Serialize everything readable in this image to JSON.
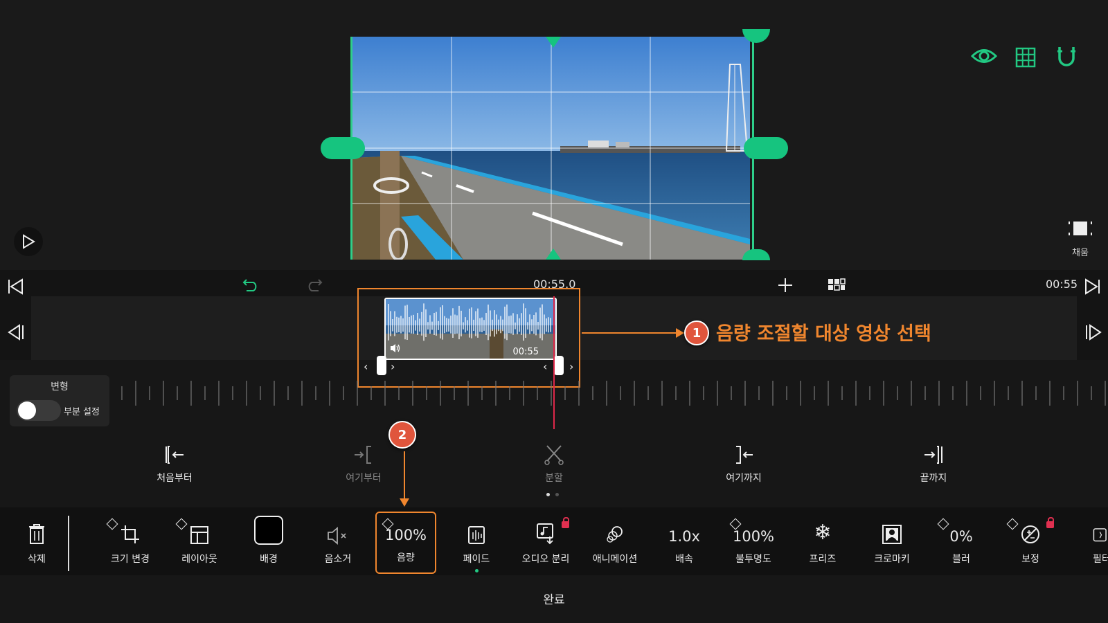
{
  "preview": {
    "fill_label": "채움",
    "icons": [
      "eye-icon",
      "grid-icon",
      "magnet-icon",
      "play-icon",
      "fill-icon"
    ],
    "accent_color": "#22c983"
  },
  "timeline": {
    "current_time": "00:55.0",
    "end_time": "00:55",
    "clip_duration": "00:55"
  },
  "callouts": {
    "one_number": "1",
    "one_text": "음량 조절할 대상 영상 선택",
    "two_number": "2",
    "color": "#f0862e"
  },
  "transform": {
    "title": "변형",
    "toggle_label": "부분 설정"
  },
  "trim_actions": [
    {
      "label": "처음부터"
    },
    {
      "label": "여기부터"
    },
    {
      "label": "분할"
    },
    {
      "label": "여기까지"
    },
    {
      "label": "끝까지"
    }
  ],
  "toolbar": {
    "delete": "삭제",
    "resize": "크기 변경",
    "layout": "레이아웃",
    "background": "배경",
    "mute": "음소거",
    "volume_value": "100%",
    "volume": "음량",
    "fade": "페이드",
    "audio_split": "오디오 분리",
    "animation": "애니메이션",
    "speed_value": "1.0x",
    "speed": "배속",
    "opacity_value": "100%",
    "opacity": "불투명도",
    "freeze": "프리즈",
    "chroma": "크로마키",
    "blur_value": "0%",
    "blur": "블러",
    "correction": "보정",
    "filter": "필터"
  },
  "done_label": "완료"
}
